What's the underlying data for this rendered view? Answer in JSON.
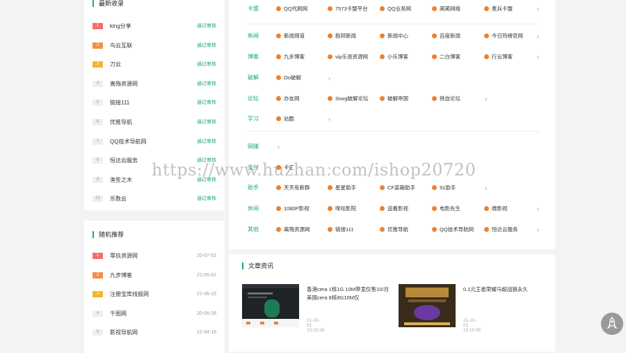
{
  "latest": {
    "title": "最新收录",
    "items": [
      {
        "rank": "1",
        "name": "king分享",
        "status": "通过审核"
      },
      {
        "rank": "2",
        "name": "鸟云互联",
        "status": "通过审核"
      },
      {
        "rank": "3",
        "name": "刀云",
        "status": "通过审核"
      },
      {
        "rank": "4",
        "name": "离殇资源网",
        "status": "通过审核"
      },
      {
        "rank": "5",
        "name": "链接111",
        "status": "通过审核"
      },
      {
        "rank": "6",
        "name": "优推导航",
        "status": "通过审核"
      },
      {
        "rank": "7",
        "name": "QQ技术导航网",
        "status": "通过审核"
      },
      {
        "rank": "8",
        "name": "恒达云服务",
        "status": "通过审核"
      },
      {
        "rank": "9",
        "name": "渔笙之木",
        "status": "通过审核"
      },
      {
        "rank": "10",
        "name": "乐数云",
        "status": "通过审核"
      }
    ]
  },
  "random": {
    "title": "随机推荐",
    "items": [
      {
        "rank": "1",
        "name": "零玖资源网",
        "date": "20-07-02"
      },
      {
        "rank": "2",
        "name": "九步博客",
        "date": "21-05-02"
      },
      {
        "rank": "3",
        "name": "注册宝库线报网",
        "date": "21-06-15"
      },
      {
        "rank": "4",
        "name": "千图网",
        "date": "20-06-26"
      },
      {
        "rank": "5",
        "name": "影视导航网",
        "date": "21-04-18"
      }
    ]
  },
  "categories": [
    {
      "name": "卡盟",
      "items": [
        "QQ代刷网",
        "7573卡盟平台",
        "QQ业务网",
        "蔺蔺网络",
        "麦兵卡盟"
      ]
    },
    {
      "name": "新闻",
      "items": [
        "新闻频道",
        "韵邦新闻",
        "新闻中心",
        "百度新闻",
        "今日热榜官网"
      ]
    },
    {
      "name": "博客",
      "items": [
        "九步博客",
        "vip乐测资源网",
        "小乐博客",
        "二白博客",
        "行云博客"
      ]
    },
    {
      "name": "破解",
      "items": [
        "Oo破解"
      ]
    },
    {
      "name": "论坛",
      "items": [
        "办友网",
        "3swg破解论坛",
        "破解帝国",
        "铁血论坛"
      ]
    },
    {
      "name": "学习",
      "items": [
        "站酷"
      ]
    },
    {
      "name": "网赚",
      "items": []
    },
    {
      "name": "支付",
      "items": [
        "卡汇"
      ]
    },
    {
      "name": "助手",
      "items": [
        "天天有新群",
        "星星助手",
        "CF装箱助手",
        "91助手"
      ]
    },
    {
      "name": "休闲",
      "items": [
        "1080P影视",
        "咪咕影院",
        "追看影视",
        "电影先生",
        "微影视"
      ]
    },
    {
      "name": "其他",
      "items": [
        "离殇资源网",
        "链接111",
        "优推导航",
        "QQ技术导航网",
        "恒达云服务"
      ]
    }
  ],
  "articles": {
    "title": "文章资讯",
    "items": [
      {
        "title": "香港cera 1核1G 10M带宽仅售10/月 美国cera 8核8G10M仅",
        "time": "21-10-01 23:10:26"
      },
      {
        "title": "0.1元王者荣耀马超战狼永久",
        "time": "21-10-01 23:10:35"
      }
    ]
  },
  "watermark": "https://www.huzhan.com/ishop20720",
  "colors": {
    "accent": "#1aa97b",
    "icon": "#f0802c"
  }
}
